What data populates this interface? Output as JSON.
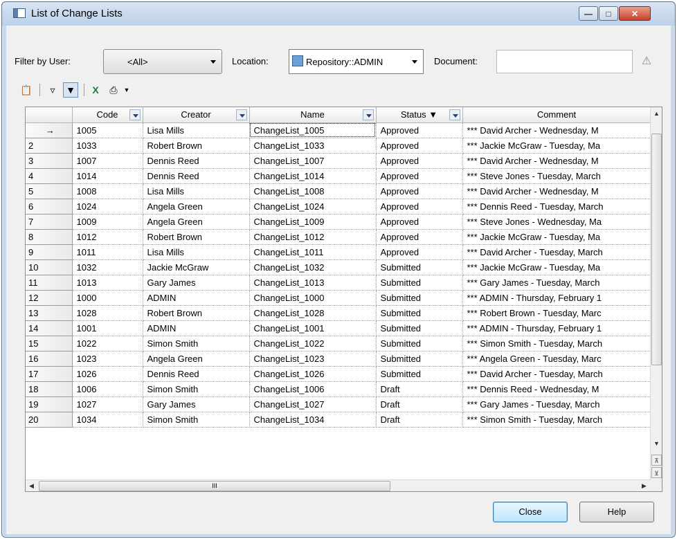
{
  "window": {
    "title": "List of Change Lists"
  },
  "filters": {
    "user_label": "Filter by User:",
    "user_value": "<All>",
    "location_label": "Location:",
    "location_value": "Repository::ADMIN",
    "document_label": "Document:",
    "document_value": ""
  },
  "toolbar": {
    "icons": [
      "properties-icon",
      "filter-icon",
      "filter-active-icon",
      "excel-export-icon",
      "print-icon"
    ]
  },
  "grid": {
    "columns": [
      "Code",
      "Creator",
      "Name",
      "Status ▼",
      "Comment"
    ],
    "current_row_marker": "→",
    "rows": [
      {
        "num": "",
        "code": "1005",
        "creator": "Lisa Mills",
        "name": "ChangeList_1005",
        "status": "Approved",
        "comment": "*** David Archer - Wednesday, M"
      },
      {
        "num": "2",
        "code": "1033",
        "creator": "Robert Brown",
        "name": "ChangeList_1033",
        "status": "Approved",
        "comment": "*** Jackie McGraw - Tuesday, Ma"
      },
      {
        "num": "3",
        "code": "1007",
        "creator": "Dennis Reed",
        "name": "ChangeList_1007",
        "status": "Approved",
        "comment": "*** David Archer - Wednesday, M"
      },
      {
        "num": "4",
        "code": "1014",
        "creator": "Dennis Reed",
        "name": "ChangeList_1014",
        "status": "Approved",
        "comment": "*** Steve Jones - Tuesday, March"
      },
      {
        "num": "5",
        "code": "1008",
        "creator": "Lisa Mills",
        "name": "ChangeList_1008",
        "status": "Approved",
        "comment": "*** David Archer - Wednesday, M"
      },
      {
        "num": "6",
        "code": "1024",
        "creator": "Angela Green",
        "name": "ChangeList_1024",
        "status": "Approved",
        "comment": "*** Dennis Reed - Tuesday, March"
      },
      {
        "num": "7",
        "code": "1009",
        "creator": "Angela Green",
        "name": "ChangeList_1009",
        "status": "Approved",
        "comment": "*** Steve Jones - Wednesday, Ma"
      },
      {
        "num": "8",
        "code": "1012",
        "creator": "Robert Brown",
        "name": "ChangeList_1012",
        "status": "Approved",
        "comment": "*** Jackie McGraw - Tuesday, Ma"
      },
      {
        "num": "9",
        "code": "1011",
        "creator": "Lisa Mills",
        "name": "ChangeList_1011",
        "status": "Approved",
        "comment": "*** David Archer - Tuesday, March"
      },
      {
        "num": "10",
        "code": "1032",
        "creator": "Jackie McGraw",
        "name": "ChangeList_1032",
        "status": "Submitted",
        "comment": "*** Jackie McGraw - Tuesday, Ma"
      },
      {
        "num": "11",
        "code": "1013",
        "creator": "Gary James",
        "name": "ChangeList_1013",
        "status": "Submitted",
        "comment": "*** Gary James - Tuesday, March"
      },
      {
        "num": "12",
        "code": "1000",
        "creator": "ADMIN",
        "name": "ChangeList_1000",
        "status": "Submitted",
        "comment": "*** ADMIN - Thursday, February 1"
      },
      {
        "num": "13",
        "code": "1028",
        "creator": "Robert Brown",
        "name": "ChangeList_1028",
        "status": "Submitted",
        "comment": "*** Robert Brown - Tuesday, Marc"
      },
      {
        "num": "14",
        "code": "1001",
        "creator": "ADMIN",
        "name": "ChangeList_1001",
        "status": "Submitted",
        "comment": "*** ADMIN - Thursday, February 1"
      },
      {
        "num": "15",
        "code": "1022",
        "creator": "Simon Smith",
        "name": "ChangeList_1022",
        "status": "Submitted",
        "comment": "*** Simon Smith - Tuesday, March"
      },
      {
        "num": "16",
        "code": "1023",
        "creator": "Angela Green",
        "name": "ChangeList_1023",
        "status": "Submitted",
        "comment": "*** Angela Green - Tuesday, Marc"
      },
      {
        "num": "17",
        "code": "1026",
        "creator": "Dennis Reed",
        "name": "ChangeList_1026",
        "status": "Submitted",
        "comment": "*** David Archer - Tuesday, March"
      },
      {
        "num": "18",
        "code": "1006",
        "creator": "Simon Smith",
        "name": "ChangeList_1006",
        "status": "Draft",
        "comment": "*** Dennis Reed - Wednesday, M"
      },
      {
        "num": "19",
        "code": "1027",
        "creator": "Gary James",
        "name": "ChangeList_1027",
        "status": "Draft",
        "comment": "*** Gary James - Tuesday, March"
      },
      {
        "num": "20",
        "code": "1034",
        "creator": "Simon Smith",
        "name": "ChangeList_1034",
        "status": "Draft",
        "comment": "*** Simon Smith - Tuesday, March"
      }
    ],
    "hscroll_grip": "III"
  },
  "buttons": {
    "close": "Close",
    "help": "Help"
  }
}
